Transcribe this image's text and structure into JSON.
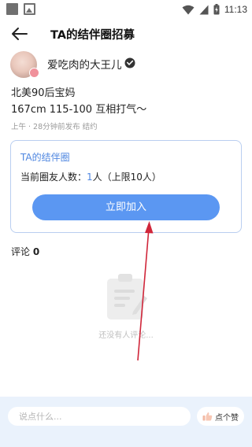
{
  "status_bar": {
    "time": "11:13",
    "icons": [
      "notification-square-icon",
      "image-icon",
      "wifi-icon",
      "signal-icon",
      "battery-icon"
    ]
  },
  "header": {
    "title": "TA的结伴圈招募",
    "back_icon": "arrow-left-icon"
  },
  "user": {
    "name": "爱吃肉的大王儿",
    "verified_icon": "verified-check-icon"
  },
  "post": {
    "line1": "北美90后宝妈",
    "line2": "167cm 115-100 互相打气～",
    "meta": "上午 · 28分钟前发布 结约"
  },
  "circle_card": {
    "title": "TA的结伴圈",
    "count_prefix": "当前圈友人数：",
    "count_value": "1",
    "count_suffix": "人（上限10人）",
    "join_label": "立即加入"
  },
  "comments": {
    "label": "评论",
    "count": "0",
    "empty_text": "还没有人评论..."
  },
  "bottom_bar": {
    "input_placeholder": "说点什么...",
    "like_label": "点个赞"
  },
  "colors": {
    "accent": "#5b97f2",
    "accent_text": "#4e86e0",
    "card_border": "#b9cef0",
    "bottom_bg": "#eaf2fc",
    "annotation_arrow": "#d0263a"
  }
}
